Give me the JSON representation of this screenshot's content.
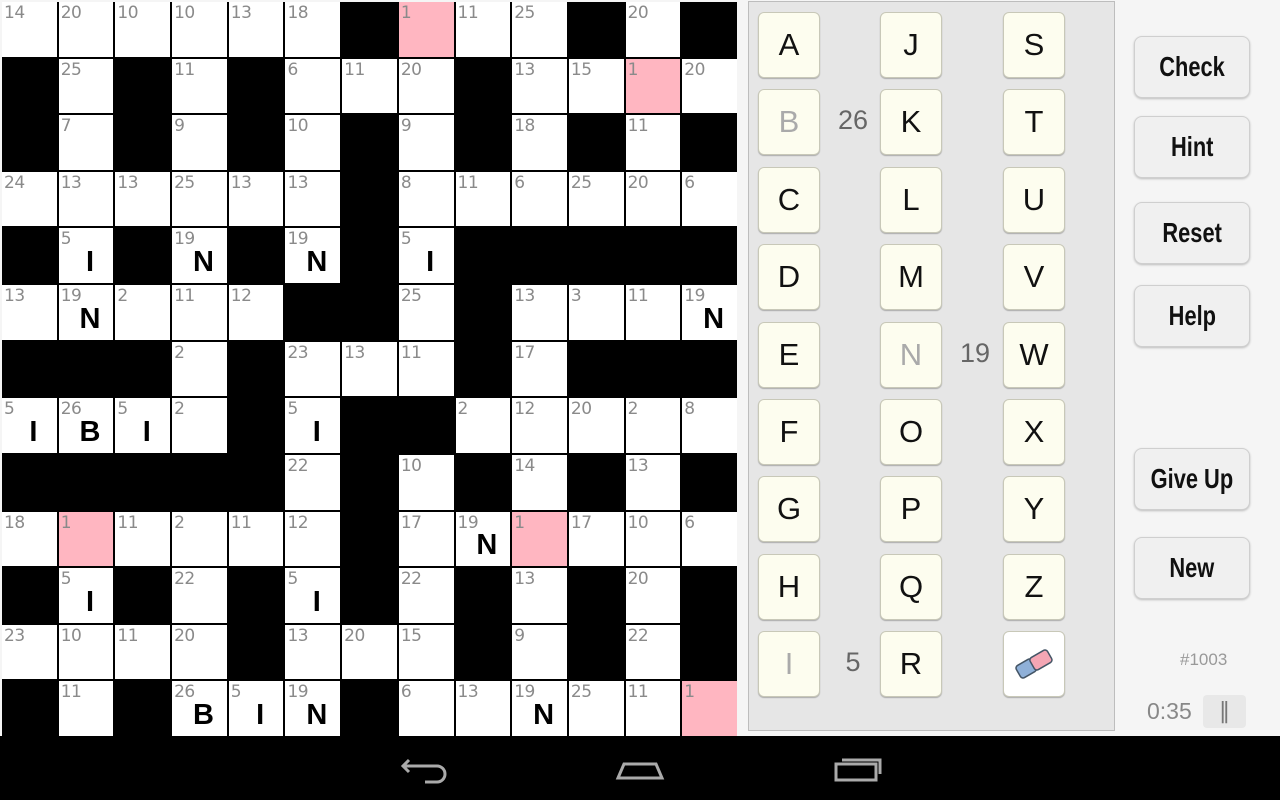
{
  "puzzle": {
    "grid": [
      [
        14,
        20,
        10,
        10,
        13,
        18,
        null,
        1,
        11,
        25,
        null,
        20,
        null
      ],
      [
        null,
        25,
        null,
        11,
        null,
        6,
        11,
        20,
        null,
        13,
        15,
        1,
        20
      ],
      [
        null,
        7,
        null,
        9,
        null,
        10,
        null,
        9,
        null,
        18,
        null,
        11,
        null
      ],
      [
        24,
        13,
        13,
        25,
        13,
        13,
        null,
        8,
        11,
        6,
        25,
        20,
        6
      ],
      [
        null,
        5,
        null,
        19,
        null,
        19,
        null,
        5,
        null,
        null,
        null,
        null,
        null
      ],
      [
        13,
        19,
        2,
        11,
        12,
        null,
        null,
        25,
        null,
        13,
        3,
        11,
        19
      ],
      [
        null,
        null,
        null,
        2,
        null,
        23,
        13,
        11,
        null,
        17,
        null,
        null,
        null
      ],
      [
        5,
        26,
        5,
        2,
        null,
        5,
        null,
        null,
        2,
        12,
        20,
        2,
        8
      ],
      [
        null,
        null,
        null,
        null,
        null,
        22,
        null,
        10,
        null,
        14,
        null,
        13,
        null
      ],
      [
        18,
        1,
        11,
        2,
        11,
        12,
        null,
        17,
        19,
        1,
        17,
        10,
        6
      ],
      [
        null,
        5,
        null,
        22,
        null,
        5,
        null,
        22,
        null,
        13,
        null,
        20,
        null
      ],
      [
        23,
        10,
        11,
        20,
        null,
        13,
        20,
        15,
        null,
        9,
        null,
        22,
        null
      ],
      [
        null,
        11,
        null,
        26,
        5,
        19,
        null,
        6,
        13,
        19,
        25,
        11,
        1
      ]
    ],
    "solved": {
      "5": "I",
      "19": "N",
      "26": "B"
    },
    "highlighted_code": 1,
    "colors": {
      "highlight": "#ffb6c1",
      "black": "#000000",
      "number": "#8a8a8a"
    }
  },
  "keyboard": {
    "columns": [
      [
        "A",
        "B",
        "C",
        "D",
        "E",
        "F",
        "G",
        "H",
        "I"
      ],
      [
        "J",
        "K",
        "L",
        "M",
        "N",
        "O",
        "P",
        "Q",
        "R"
      ],
      [
        "S",
        "T",
        "U",
        "V",
        "W",
        "X",
        "Y",
        "Z"
      ]
    ],
    "used": {
      "B": "26",
      "N": "19",
      "I": "5"
    },
    "eraser_icon": "eraser-icon"
  },
  "buttons": {
    "check": "Check",
    "hint": "Hint",
    "reset": "Reset",
    "help": "Help",
    "give_up": "Give Up",
    "new": "New"
  },
  "status": {
    "puzzle_number": "#1003",
    "timer": "0:35",
    "pause_icon": "pause-icon"
  },
  "navbar": {
    "back_icon": "back-icon",
    "home_icon": "home-icon",
    "recents_icon": "recents-icon"
  }
}
